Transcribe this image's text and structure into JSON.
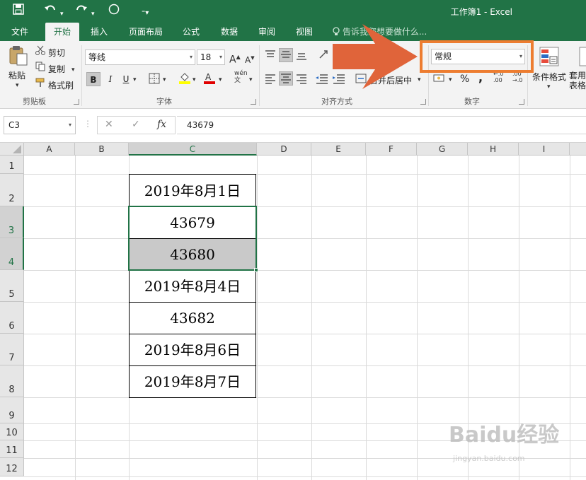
{
  "app": {
    "title": "工作簿1 - Excel",
    "quick_access": {
      "save_icon": "save-icon",
      "undo_icon": "undo-icon",
      "redo_icon": "redo-icon",
      "touch_icon": "touch-mode-icon",
      "customize_icon": "customize-qat-icon"
    }
  },
  "tabs": [
    "文件",
    "开始",
    "插入",
    "页面布局",
    "公式",
    "数据",
    "审阅",
    "视图"
  ],
  "active_tab": "开始",
  "tell_me": "告诉我您想要做什么...",
  "ribbon": {
    "clipboard": {
      "label": "剪贴板",
      "paste": "粘贴",
      "cut": "剪切",
      "copy": "复制",
      "format_painter": "格式刷"
    },
    "font": {
      "label": "字体",
      "name": "等线",
      "size": "18",
      "bold": "B",
      "italic": "I",
      "underline": "U",
      "grow": "A",
      "shrink": "A",
      "phonetic": "wén"
    },
    "alignment": {
      "label": "对齐方式",
      "merge_center": "合并后居中"
    },
    "number": {
      "label": "数字",
      "format": "常规",
      "percent": "%",
      "comma": ","
    },
    "styles": {
      "conditional_format": "条件格式",
      "format_as_table": "套用表格"
    }
  },
  "formula_bar": {
    "name_box": "C3",
    "formula": "43679",
    "cancel": "✕",
    "enter": "✓",
    "fx": "fx"
  },
  "columns": [
    "A",
    "B",
    "C",
    "D",
    "E",
    "F",
    "G",
    "H",
    "I"
  ],
  "selected_column": "C",
  "rows": [
    "1",
    "2",
    "3",
    "4",
    "5",
    "6",
    "7",
    "8",
    "9",
    "10",
    "11",
    "12"
  ],
  "selected_rows": [
    "3",
    "4"
  ],
  "cells": [
    {
      "ref": "C2",
      "value": "2019年8月1日"
    },
    {
      "ref": "C3",
      "value": "43679"
    },
    {
      "ref": "C4",
      "value": "43680"
    },
    {
      "ref": "C5",
      "value": "2019年8月4日"
    },
    {
      "ref": "C6",
      "value": "43682"
    },
    {
      "ref": "C7",
      "value": "2019年8月6日"
    },
    {
      "ref": "C8",
      "value": "2019年8月7日"
    }
  ],
  "colors": {
    "excel_green": "#217346",
    "annotation_orange": "#ed7d31",
    "arrow": "#e0643a"
  },
  "watermark": {
    "brand": "Baidu经验",
    "site": "jingyan.baidu.com"
  }
}
